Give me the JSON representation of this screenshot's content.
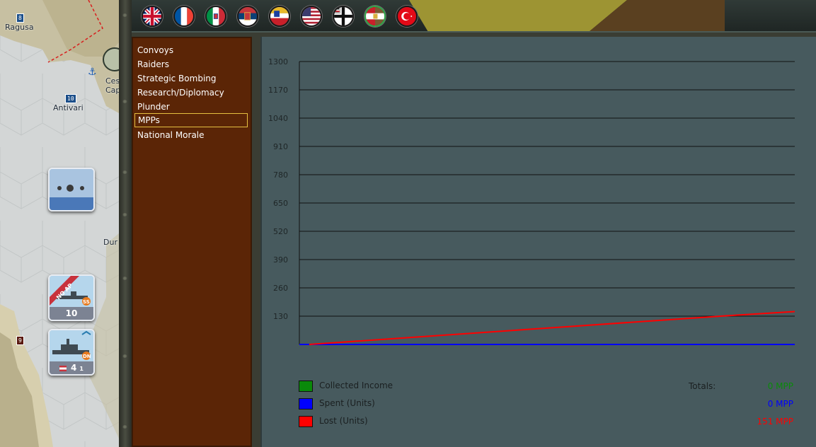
{
  "map": {
    "labels": [
      "Ragusa",
      "Antivari",
      "Ces",
      "Cap",
      "Dur"
    ],
    "hex_badges": [
      "8",
      "10",
      "9"
    ],
    "counters": [
      {
        "strength": ""
      },
      {
        "strength": "10",
        "tag": "NO AP",
        "type": "SS"
      },
      {
        "strength": "4",
        "sub": "1",
        "type": "DN"
      }
    ]
  },
  "flags": [
    {
      "name": "uk-flag-icon"
    },
    {
      "name": "france-flag-icon"
    },
    {
      "name": "italy-flag-icon"
    },
    {
      "name": "serbia-flag-icon"
    },
    {
      "name": "russia-flag-icon"
    },
    {
      "name": "usa-flag-icon"
    },
    {
      "name": "germany-flag-icon"
    },
    {
      "name": "austria-hungary-flag-icon"
    },
    {
      "name": "turkey-flag-icon"
    }
  ],
  "categories": [
    {
      "label": "Convoys"
    },
    {
      "label": "Raiders"
    },
    {
      "label": "Strategic Bombing"
    },
    {
      "label": "Research/Diplomacy"
    },
    {
      "label": "Plunder"
    },
    {
      "label": "MPPs",
      "selected": true
    },
    {
      "label": "National Morale"
    }
  ],
  "legend": {
    "totals_label": "Totals:",
    "items": [
      {
        "label": "Collected Income",
        "color": "#0a8a0a",
        "total": "0 MPP"
      },
      {
        "label": "Spent (Units)",
        "color": "#0000ff",
        "total": "0 MPP"
      },
      {
        "label": "Lost (Units)",
        "color": "#ff0000",
        "total": "151 MPP"
      }
    ]
  },
  "chart_data": {
    "type": "line",
    "y_ticks": [
      1300,
      1170,
      1040,
      910,
      780,
      650,
      520,
      390,
      260,
      130
    ],
    "ylim": [
      0,
      1300
    ],
    "grid": true,
    "series": [
      {
        "name": "Collected Income",
        "color": "#0a8a0a",
        "points": []
      },
      {
        "name": "Spent (Units)",
        "color": "#0000ff",
        "points": [
          [
            0,
            0
          ],
          [
            1,
            0
          ]
        ]
      },
      {
        "name": "Lost (Units)",
        "color": "#ff0000",
        "points": [
          [
            0.02,
            0
          ],
          [
            0.85,
            130
          ],
          [
            1,
            151
          ]
        ]
      }
    ]
  }
}
